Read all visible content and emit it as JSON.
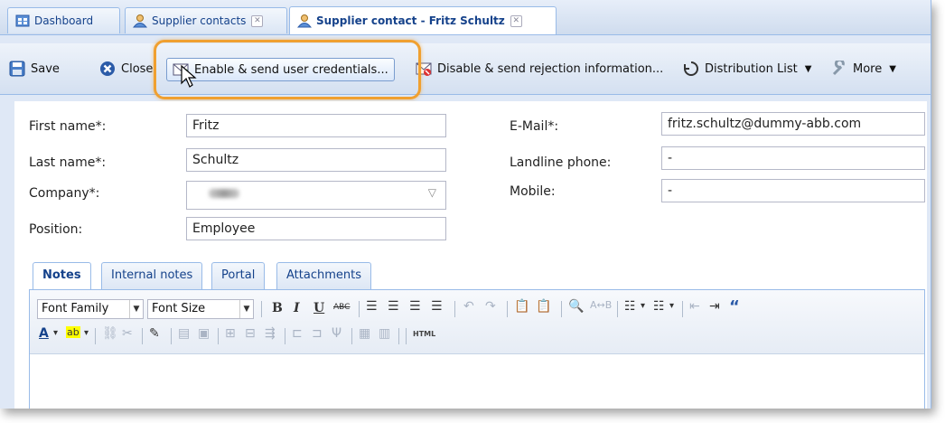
{
  "tabs": [
    {
      "label": "Dashboard",
      "icon": "dashboard-icon"
    },
    {
      "label": "Supplier contacts",
      "icon": "contacts-icon"
    },
    {
      "label": "Supplier contact - Fritz Schultz",
      "icon": "contact-icon",
      "active": true
    }
  ],
  "toolbar": {
    "save": "Save",
    "close": "Close",
    "enable_send": "Enable & send user credentials...",
    "disable_send": "Disable & send rejection information...",
    "distribution_list": "Distribution List",
    "more": "More"
  },
  "form": {
    "first_name_label": "First name*:",
    "first_name_value": "Fritz",
    "last_name_label": "Last name*:",
    "last_name_value": "Schultz",
    "company_label": "Company*:",
    "position_label": "Position:",
    "position_value": "Employee",
    "email_label": "E-Mail*:",
    "email_value": "fritz.schultz@dummy-abb.com",
    "landline_label": "Landline phone:",
    "landline_value": "-",
    "mobile_label": "Mobile:",
    "mobile_value": "-"
  },
  "inner_tabs": [
    "Notes",
    "Internal notes",
    "Portal",
    "Attachments"
  ],
  "editor": {
    "font_family": "Font Family",
    "font_size": "Font Size",
    "html_label": "HTML"
  },
  "colors": {
    "accent": "#15428b",
    "highlight": "#f0a030",
    "panel": "#dfe8f6"
  }
}
